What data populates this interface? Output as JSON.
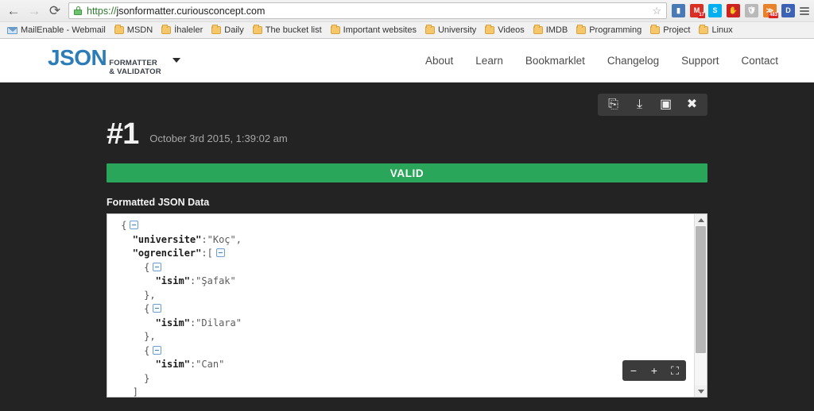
{
  "browser": {
    "nav": {
      "back": "←",
      "forward": "→",
      "reload": "⟳"
    },
    "omnibox": {
      "scheme": "https://",
      "host": "jsonformatter.curiousconcept.com",
      "full_url": "https://jsonformatter.curiousconcept.com",
      "lock_icon": "lock-icon",
      "star_icon": "star-icon"
    },
    "extensions": [
      {
        "name": "bar-chart-extension-icon",
        "glyph": "▮",
        "color": "#4a7ab5",
        "badge": ""
      },
      {
        "name": "gmail-extension-icon",
        "glyph": "M",
        "color": "#d93025",
        "badge": "17"
      },
      {
        "name": "skype-extension-icon",
        "glyph": "S",
        "color": "#00aff0",
        "badge": ""
      },
      {
        "name": "adblock-extension-icon",
        "glyph": "✋",
        "color": "#cc2222",
        "badge": ""
      },
      {
        "name": "shield-extension-icon",
        "glyph": "🛡",
        "color": "#b9b9b9",
        "badge": ""
      },
      {
        "name": "rss-feed-extension-icon",
        "glyph": "≫",
        "color": "#e8822a",
        "badge": "483"
      },
      {
        "name": "d-extension-icon",
        "glyph": "D",
        "color": "#3b62b5",
        "badge": ""
      }
    ],
    "menu_icon": "hamburger-menu-icon",
    "bookmarks": [
      {
        "label": "MailEnable - Webmail",
        "icon": "mail-icon"
      },
      {
        "label": "MSDN",
        "icon": "folder-icon"
      },
      {
        "label": "İhaleler",
        "icon": "folder-icon"
      },
      {
        "label": "Daily",
        "icon": "folder-icon"
      },
      {
        "label": "The bucket list",
        "icon": "folder-icon"
      },
      {
        "label": "Important websites",
        "icon": "folder-icon"
      },
      {
        "label": "University",
        "icon": "folder-icon"
      },
      {
        "label": "Videos",
        "icon": "folder-icon"
      },
      {
        "label": "IMDB",
        "icon": "folder-icon"
      },
      {
        "label": "Programming",
        "icon": "folder-icon"
      },
      {
        "label": "Project",
        "icon": "folder-icon"
      },
      {
        "label": "Linux",
        "icon": "folder-icon"
      }
    ]
  },
  "site": {
    "logo": {
      "primary": "JSON",
      "line1": "FORMATTER",
      "line2": "& VALIDATOR",
      "primary_color": "#2b7cb8"
    },
    "nav": [
      {
        "label": "About"
      },
      {
        "label": "Learn"
      },
      {
        "label": "Bookmarklet"
      },
      {
        "label": "Changelog"
      },
      {
        "label": "Support"
      },
      {
        "label": "Contact"
      }
    ]
  },
  "result": {
    "number": "#1",
    "timestamp": "October 3rd 2015, 1:39:02 am",
    "status": "VALID",
    "status_color": "#2aa65a",
    "section_label": "Formatted JSON Data",
    "actions": [
      {
        "name": "copy-button",
        "glyph": "⎘"
      },
      {
        "name": "download-button",
        "glyph": "⤓"
      },
      {
        "name": "save-image-button",
        "glyph": "▣"
      },
      {
        "name": "close-button",
        "glyph": "✖"
      }
    ],
    "zoom_controls": [
      {
        "name": "zoom-out-button",
        "glyph": "−"
      },
      {
        "name": "zoom-in-button",
        "glyph": "+"
      },
      {
        "name": "fullscreen-button",
        "glyph": "⛶"
      }
    ],
    "json_lines": [
      {
        "indent": 0,
        "text": "{",
        "fold": true
      },
      {
        "indent": 1,
        "key": "\"universite\"",
        "sep": ":",
        "value": "\"Koç\"",
        "tail": ","
      },
      {
        "indent": 1,
        "key": "\"ogrenciler\"",
        "sep": ":",
        "value": "[",
        "fold": true
      },
      {
        "indent": 2,
        "text": "{",
        "fold": true
      },
      {
        "indent": 3,
        "key": "\"isim\"",
        "sep": ":",
        "value": "\"Şafak\""
      },
      {
        "indent": 2,
        "text": "},"
      },
      {
        "indent": 2,
        "text": "{",
        "fold": true
      },
      {
        "indent": 3,
        "key": "\"isim\"",
        "sep": ":",
        "value": "\"Dilara\""
      },
      {
        "indent": 2,
        "text": "},"
      },
      {
        "indent": 2,
        "text": "{",
        "fold": true
      },
      {
        "indent": 3,
        "key": "\"isim\"",
        "sep": ":",
        "value": "\"Can\""
      },
      {
        "indent": 2,
        "text": "}"
      },
      {
        "indent": 1,
        "text": "]"
      },
      {
        "indent": 0,
        "text": "}"
      }
    ]
  }
}
